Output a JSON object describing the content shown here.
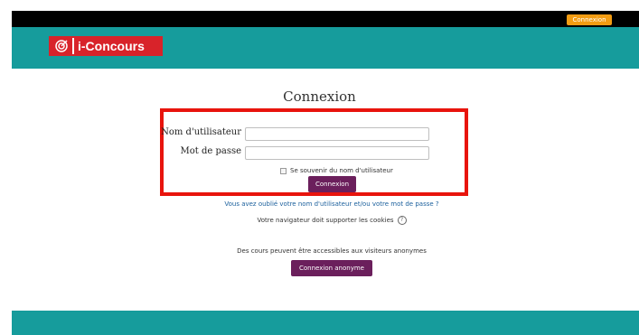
{
  "topbar": {
    "login_button": "Connexion"
  },
  "brand": {
    "name": "i-Concours"
  },
  "login": {
    "title": "Connexion",
    "username_label": "Nom d'utilisateur",
    "username_value": "",
    "password_label": "Mot de passe",
    "password_value": "",
    "remember_label": "Se souvenir du nom d'utilisateur",
    "submit_label": "Connexion",
    "forgot_link": "Vous avez oublié votre nom d'utilisateur et/ou votre mot de passe ?",
    "cookies_note": "Votre navigateur doit supporter les cookies"
  },
  "guest": {
    "note": "Des cours peuvent être accessibles aux visiteurs anonymes",
    "button_label": "Connexion anonyme"
  },
  "colors": {
    "header": "#169c9c",
    "accent_button": "#6b1f5c",
    "top_login": "#f39c12",
    "logo_red": "#d8232a",
    "highlight_border": "#e8140d"
  }
}
